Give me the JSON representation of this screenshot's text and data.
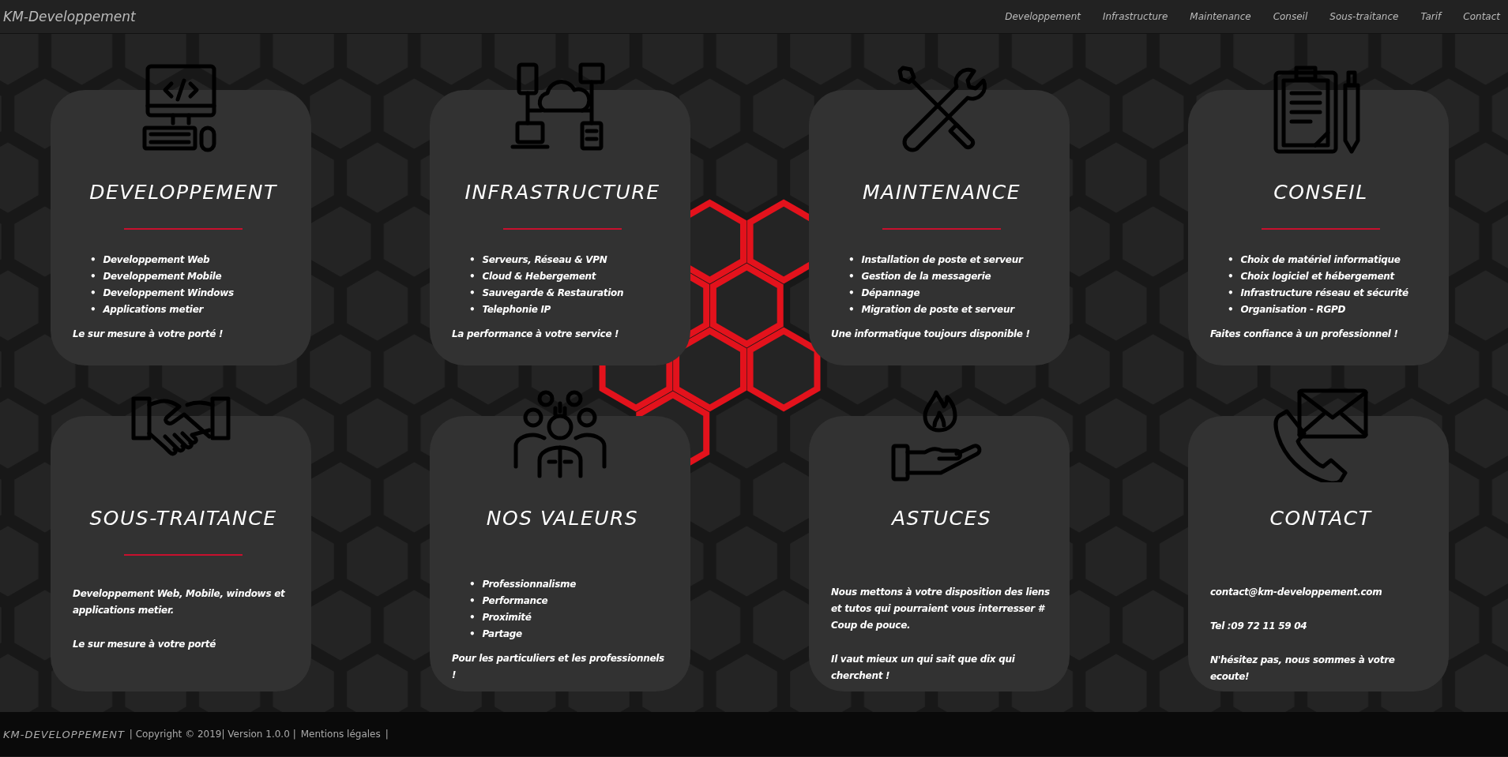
{
  "navbar": {
    "brand": "KM-Developpement",
    "links": [
      {
        "label": "Developpement"
      },
      {
        "label": "Infrastructure"
      },
      {
        "label": "Maintenance"
      },
      {
        "label": "Conseil"
      },
      {
        "label": "Sous-traitance"
      },
      {
        "label": "Tarif"
      },
      {
        "label": "Contact"
      }
    ]
  },
  "cards": [
    {
      "title": "DEVELOPPEMENT",
      "marker": "•",
      "items": [
        "Developpement Web",
        "Developpement Mobile",
        "Developpement Windows",
        "Applications metier"
      ],
      "paragraphs": [
        "Le sur mesure à votre porté !"
      ]
    },
    {
      "title": "INFRASTRUCTURE",
      "marker": "•",
      "items": [
        "Serveurs, Réseau & VPN",
        "Cloud & Hebergement",
        "Sauvegarde & Restauration",
        "Telephonie IP"
      ],
      "paragraphs": [
        "La performance à votre service !"
      ]
    },
    {
      "title": "MAINTENANCE",
      "marker": "•",
      "items": [
        "Installation de poste et serveur",
        "Gestion de la messagerie",
        "Dépannage",
        "Migration de poste et serveur"
      ],
      "paragraphs": [
        "Une informatique toujours disponible !"
      ]
    },
    {
      "title": "CONSEIL",
      "marker": "•",
      "items": [
        "Choix de matériel informatique",
        "Choix logiciel et hébergement",
        "Infrastructure réseau et sécurité",
        "Organisation - RGPD"
      ],
      "paragraphs": [
        "Faites confiance à un professionnel !"
      ]
    },
    {
      "title": "SOUS-TRAITANCE",
      "paragraphs": [
        "Developpement Web, Mobile, windows et applications metier.",
        "Le sur mesure à votre porté"
      ]
    },
    {
      "title": "NOS VALEURS",
      "marker": "•",
      "items": [
        "Professionnalisme",
        "Performance",
        "Proximité",
        "Partage"
      ],
      "paragraphs": [
        "Pour les particuliers et les professionnels !"
      ]
    },
    {
      "title": "ASTUCES",
      "paragraphs": [
        "Nous mettons à votre disposition des liens et tutos qui pourraient vous interresser # Coup de pouce.",
        "Il vaut mieux un qui sait que dix qui cherchent !"
      ]
    },
    {
      "title": "CONTACT",
      "paragraphs": [
        "contact@km-developpement.com",
        "Tel :09 72 11 59 04",
        "N'hésitez pas, nous sommes à votre ecoute!"
      ]
    }
  ],
  "footer": {
    "brand": "KM-DEVELOPPEMENT",
    "copyright": "| Copyright © 2019| Version 1.0.0 |",
    "legal_link": "Mentions légales",
    "end": "|"
  }
}
